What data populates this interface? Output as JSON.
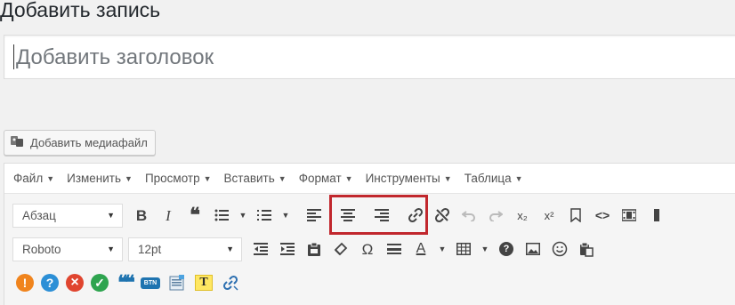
{
  "page": {
    "title": "Добавить запись"
  },
  "title_field": {
    "placeholder": "Добавить заголовок"
  },
  "media": {
    "button_label": "Добавить медиафайл"
  },
  "menubar": {
    "items": [
      {
        "label": "Файл",
        "arrow": "▼"
      },
      {
        "label": "Изменить",
        "arrow": "▼"
      },
      {
        "label": "Просмотр",
        "arrow": "▼"
      },
      {
        "label": "Вставить",
        "arrow": "▼"
      },
      {
        "label": "Формат",
        "arrow": "▼"
      },
      {
        "label": "Инструменты",
        "arrow": "▼"
      },
      {
        "label": "Таблица",
        "arrow": "▼"
      }
    ]
  },
  "toolbar": {
    "block_format": "Абзац",
    "font_family": "Roboto",
    "font_size": "12pt",
    "bold": "B",
    "italic": "I",
    "quote": "❝",
    "omega": "Ω",
    "text_color": "A",
    "subscript": "x₂",
    "superscript": "x²",
    "code": "<>",
    "help": "?",
    "dropdown_arrow": "▼"
  },
  "shortcodes": {
    "warning": "!",
    "question": "?",
    "error": "×",
    "check": "✓",
    "quote": "❝❝",
    "btn": "BTN",
    "highlight": "T"
  },
  "colors": {
    "highlight_border": "#c1272d",
    "warning": "#f0841d",
    "info": "#2c8fd6",
    "error": "#e0452f",
    "success": "#2ea44f",
    "quote": "#1f74b0"
  }
}
